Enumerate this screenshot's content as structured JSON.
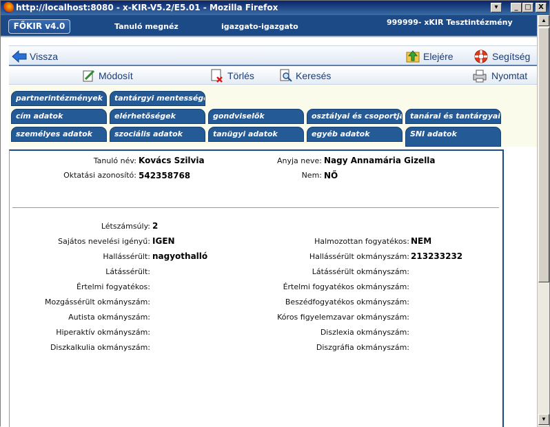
{
  "window": {
    "title": "http://localhost:8080 - x-KIR-V5.2/E5.01 - Mozilla Firefox",
    "buttons": [
      "▾",
      "_",
      "□",
      "X"
    ]
  },
  "header": {
    "logo": "FŐKIR v4.0",
    "module": "Tanuló megnéz",
    "user": "igazgato-igazgato",
    "institution": "999999- xKIR Tesztintézmény"
  },
  "nav": {
    "back": "Vissza",
    "first": "Elejére",
    "help": "Segítség"
  },
  "toolbar": {
    "modify": "Módosít",
    "delete": "Törlés",
    "search": "Keresés",
    "print": "Nyomtat"
  },
  "tabs": [
    "partnerintézmények",
    "tantárgyi mentességek",
    "cím adatok",
    "elérhetőségek",
    "gondviselők",
    "osztályai és csoportjai",
    "tanárai és tantárgyai",
    "személyes adatok",
    "szociális adatok",
    "tanügyi adatok",
    "egyéb adatok",
    "SNI adatok"
  ],
  "student": {
    "name_label": "Tanuló név:",
    "name": "Kovács Szilvia",
    "mother_label": "Anyja neve:",
    "mother": "Nagy Annamária Gizella",
    "id_label": "Oktatási azonosító:",
    "id": "542358768",
    "sex_label": "Nem:",
    "sex": "NŐ"
  },
  "sni": {
    "letszamsuly_label": "Létszámsúly:",
    "letszamsuly": "2",
    "sajatos_label": "Sajátos nevelési igényű:",
    "sajatos": "IGEN",
    "halmozott_label": "Halmozottan fogyatékos:",
    "halmozott": "NEM",
    "hallas_label": "Hallássérült:",
    "hallas": "nagyothalló",
    "hallas_okm_label": "Hallássérült okmányszám:",
    "hallas_okm": "213233232",
    "latas_label": "Látássérült:",
    "latas_okm_label": "Látássérült okmányszám:",
    "ertelmi_label": "Értelmi fogyatékos:",
    "ertelmi_okm_label": "Értelmi fogyatékos okmányszám:",
    "mozgas_okm_label": "Mozgássérült okmányszám:",
    "beszed_okm_label": "Beszédfogyatékos okmányszám:",
    "autista_okm_label": "Autista okmányszám:",
    "koros_okm_label": "Kóros figyelemzavar okmányszám:",
    "hiperaktiv_okm_label": "Hiperaktív okmányszám:",
    "diszlexia_okm_label": "Diszlexia okmányszám:",
    "diszkalkulia_okm_label": "Diszkalkulia okmányszám:",
    "diszgrafia_okm_label": "Diszgráfia okmányszám:"
  },
  "colors": {
    "header": "#1b4a86",
    "tab": "#245a96",
    "tabs_bg": "#fafbeb"
  }
}
